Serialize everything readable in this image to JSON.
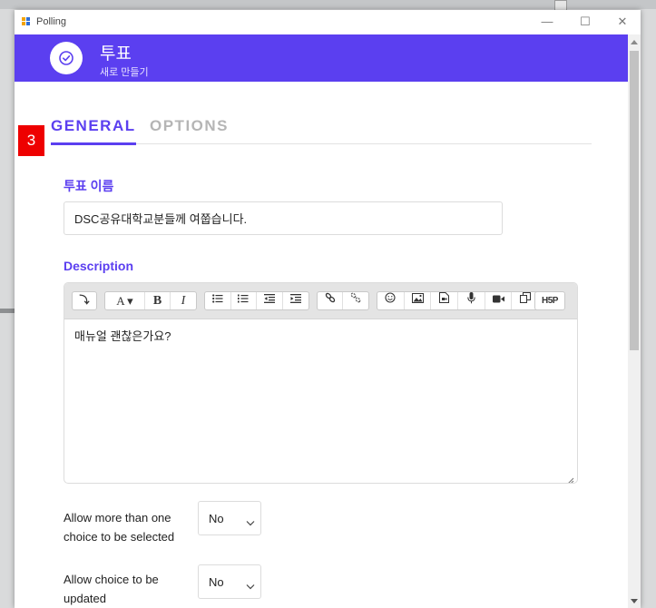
{
  "window": {
    "title": "Polling",
    "controls": {
      "minimize": "—",
      "maximize": "☐",
      "close": "✕"
    }
  },
  "header": {
    "title": "투표",
    "subtitle": "새로 만들기",
    "icon": "check-circle-icon",
    "color": "#5b3ff0"
  },
  "step_badge": "3",
  "tabs": [
    {
      "label": "GENERAL",
      "active": true
    },
    {
      "label": "OPTIONS",
      "active": false
    }
  ],
  "poll_name": {
    "label": "투표 이름",
    "value": "DSC공유대학교분들께 여쭙습니다."
  },
  "description": {
    "label": "Description",
    "content": "매뉴얼 괜찮은가요?",
    "toolbar": {
      "expand": "⤵",
      "font_style": "A ▾",
      "bold": "B",
      "italic": "I",
      "bullet_list_icon": "bullet-list-icon",
      "numbered_list_icon": "numbered-list-icon",
      "outdent_icon": "outdent-icon",
      "indent_icon": "indent-icon",
      "link_icon": "link-icon",
      "unlink_icon": "unlink-icon",
      "emoji_icon": "emoji-icon",
      "image_icon": "image-icon",
      "media_icon": "media-icon",
      "record_audio_icon": "microphone-icon",
      "record_video_icon": "video-camera-icon",
      "manage_files_icon": "copy-files-icon",
      "h5p": "H5P"
    }
  },
  "options": [
    {
      "label": "Allow more than one choice to be selected",
      "value": "No"
    },
    {
      "label": "Allow choice to be updated",
      "value": "No"
    }
  ]
}
